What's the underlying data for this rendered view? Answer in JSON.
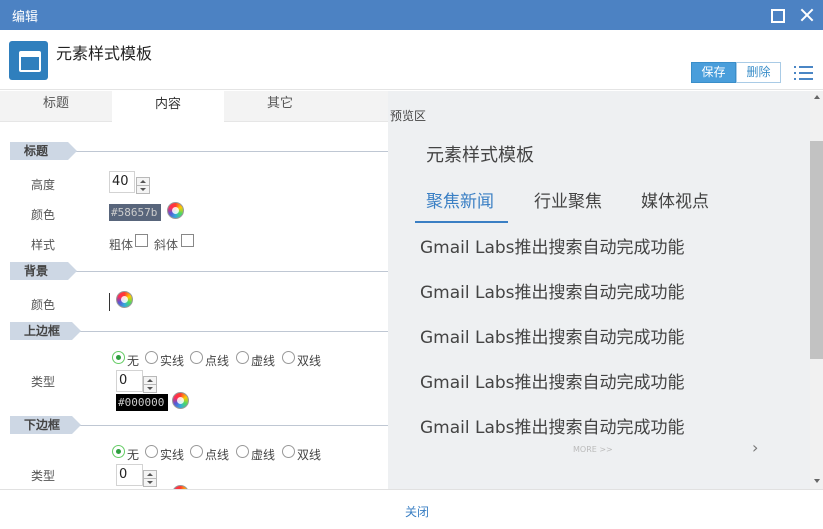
{
  "window": {
    "title": "编辑",
    "maximize_icon": "maximize-icon",
    "close_icon": "close-icon"
  },
  "header": {
    "title": "元素样式模板",
    "icon": "window-template-icon",
    "save_label": "保存",
    "delete_label": "删除",
    "menu_icon": "list-menu-icon"
  },
  "tabs": [
    {
      "label": "标题",
      "active": false
    },
    {
      "label": "内容",
      "active": true
    },
    {
      "label": "其它",
      "active": false
    }
  ],
  "sections": {
    "title": {
      "tag": "标题",
      "height_label": "高度",
      "height_value": "40",
      "color_label": "颜色",
      "color_value": "#58657b",
      "style_label": "样式",
      "bold_label": "粗体",
      "italic_label": "斜体",
      "bold_checked": false,
      "italic_checked": false
    },
    "background": {
      "tag": "背景",
      "color_label": "颜色",
      "color_value": ""
    },
    "top_border": {
      "tag": "上边框",
      "type_label": "类型",
      "options": [
        "无",
        "实线",
        "点线",
        "虚线",
        "双线"
      ],
      "selected": "无",
      "width_value": "0",
      "color_value": "#000000"
    },
    "bottom_border": {
      "tag": "下边框",
      "type_label": "类型",
      "options": [
        "无",
        "实线",
        "点线",
        "虚线",
        "双线"
      ],
      "selected": "无",
      "width_value": "0"
    }
  },
  "preview": {
    "label": "预览区",
    "title": "元素样式模板",
    "tabs": [
      {
        "label": "聚焦新闻",
        "active": true
      },
      {
        "label": "行业聚焦",
        "active": false
      },
      {
        "label": "媒体视点",
        "active": false
      }
    ],
    "items": [
      "Gmail Labs推出搜索自动完成功能",
      "Gmail Labs推出搜索自动完成功能",
      "Gmail Labs推出搜索自动完成功能",
      "Gmail Labs推出搜索自动完成功能",
      "Gmail Labs推出搜索自动完成功能"
    ],
    "more_label": "MORE >>",
    "next_glyph": "›"
  },
  "footer": {
    "close_label": "关闭"
  },
  "colors": {
    "titlebar": "#4c82c3",
    "accent": "#3a7fc4",
    "save_button": "#4a9edb",
    "title_swatch": "#58657b",
    "border_swatch": "#000000"
  }
}
